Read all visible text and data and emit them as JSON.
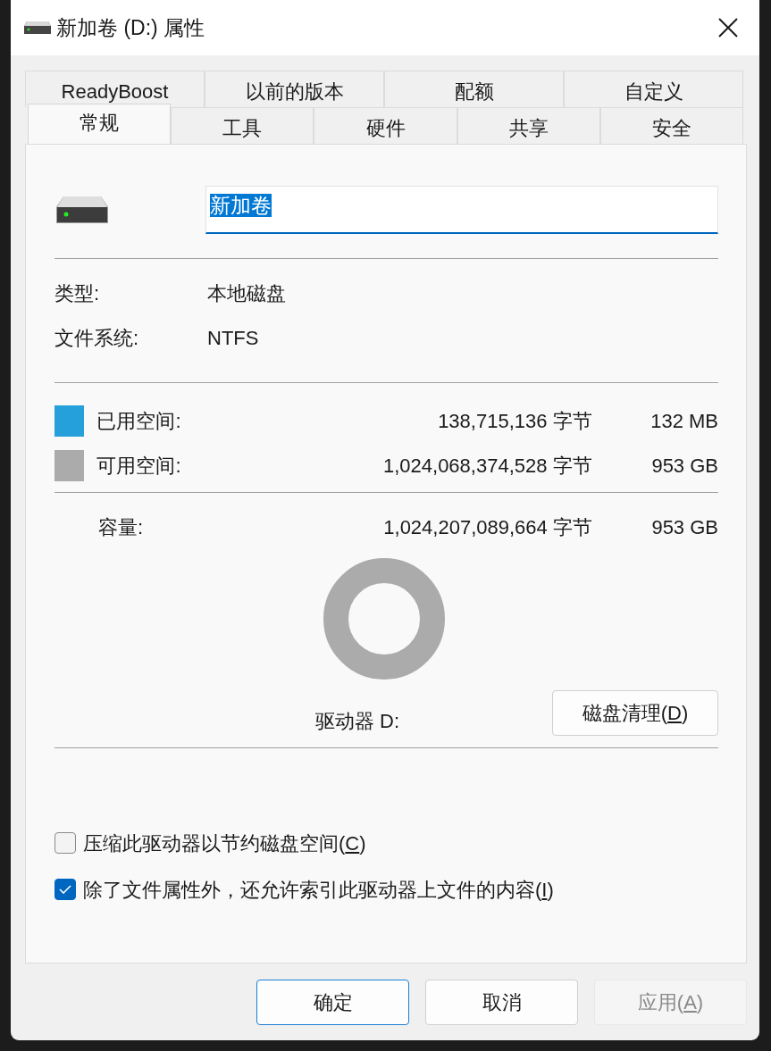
{
  "window": {
    "title": "新加卷 (D:) 属性"
  },
  "tab_rows": [
    {
      "tabs": [
        {
          "label": "ReadyBoost",
          "selected": false
        },
        {
          "label": "以前的版本",
          "selected": false
        },
        {
          "label": "配额",
          "selected": false
        },
        {
          "label": "自定义",
          "selected": false
        }
      ]
    },
    {
      "tabs": [
        {
          "label": "常规",
          "selected": true
        },
        {
          "label": "工具",
          "selected": false
        },
        {
          "label": "硬件",
          "selected": false
        },
        {
          "label": "共享",
          "selected": false
        },
        {
          "label": "安全",
          "selected": false
        }
      ]
    }
  ],
  "volume_name": {
    "value": "新加卷",
    "highlighted": true
  },
  "info": [
    {
      "label": "类型:",
      "value": "本地磁盘"
    },
    {
      "label": "文件系统:",
      "value": "NTFS"
    }
  ],
  "space": [
    {
      "label": "已用空间:",
      "bytes": "138,715,136 字节",
      "size": "132 MB",
      "color": "#26a0da"
    },
    {
      "label": "可用空间:",
      "bytes": "1,024,068,374,528 字节",
      "size": "953 GB",
      "color": "#ababab"
    }
  ],
  "capacity": {
    "label": "容量:",
    "bytes": "1,024,207,089,664 字节",
    "size": "953 GB"
  },
  "drive_label": "驱动器 D:",
  "cleanup_button": {
    "label": "磁盘清理(",
    "access_key": "D",
    "label_end": ")"
  },
  "options": [
    {
      "label": "压缩此驱动器以节约磁盘空间(",
      "access_key": "C",
      "label_end": ")",
      "checked": false
    },
    {
      "label": "除了文件属性外，还允许索引此驱动器上文件的内容(",
      "access_key": "I",
      "label_end": ")",
      "checked": true
    }
  ],
  "buttons": [
    {
      "label": "确定",
      "kind": "default"
    },
    {
      "label": "取消",
      "kind": "normal"
    },
    {
      "label": "应用(",
      "access_key": "A",
      "label_end": ")",
      "kind": "disabled"
    }
  ]
}
